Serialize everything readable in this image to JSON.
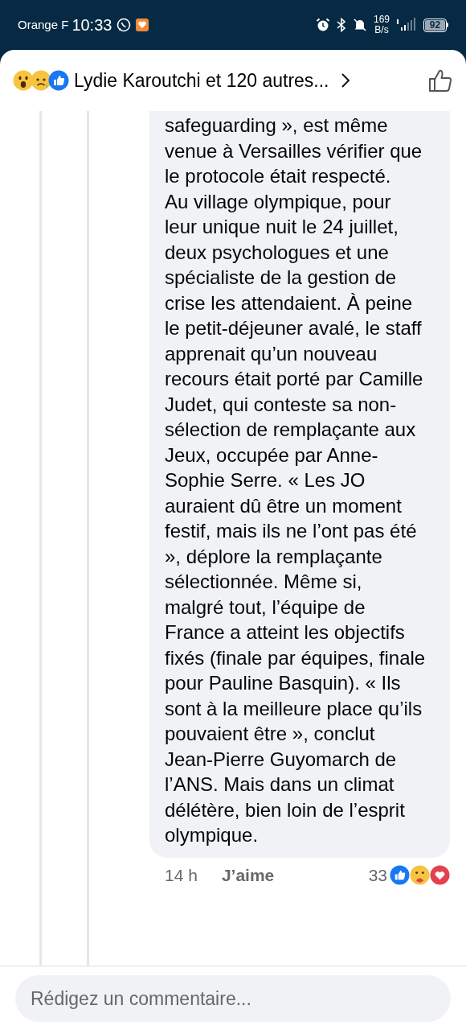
{
  "status_bar": {
    "carrier": "Orange F",
    "time": "10:33",
    "speed_value": "169",
    "speed_unit": "B/s",
    "battery": "92"
  },
  "header": {
    "reactions_summary": "Lydie Karoutchi et 120 autres...",
    "liked": false
  },
  "comment": {
    "paragraphs": [
      "safeguarding », est même venue à Versailles vérifier que le protocole était respecté.",
      "Au village olympique, pour leur unique nuit le 24 juillet, deux psychologues et une spécialiste de la gestion de crise les attendaient. À peine le petit-déjeuner avalé, le staff apprenait qu’un nouveau recours était porté par Camille Judet, qui conteste sa non-sélection de remplaçante aux Jeux, occupée par Anne-Sophie Serre. « Les JO auraient dû être un moment festif, mais ils ne l’ont pas été », déplore la remplaçante sélectionnée. Même si, malgré tout, l’équipe de France a atteint les objectifs fixés (finale par équipes, finale pour Pauline Basquin). « Ils sont à la meilleure place qu’ils pouvaient être », conclut Jean-Pierre Guyomarch de l’ANS. Mais dans un climat délétère, bien loin de l’esprit olympique."
    ],
    "time": "14 h",
    "like_label": "J’aime",
    "reaction_count": "33"
  },
  "composer": {
    "placeholder": "Rédigez un commentaire..."
  }
}
